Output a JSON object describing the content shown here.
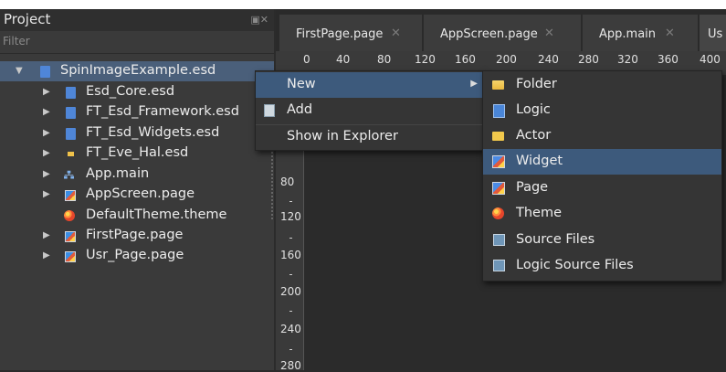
{
  "project": {
    "title": "Project",
    "filter_placeholder": "Filter",
    "tree": [
      {
        "label": "SpinImageExample.esd",
        "icon": "esd-file-icon",
        "expanded": true
      },
      {
        "label": "Esd_Core.esd",
        "icon": "esd-file-icon"
      },
      {
        "label": "FT_Esd_Framework.esd",
        "icon": "esd-file-icon"
      },
      {
        "label": "FT_Esd_Widgets.esd",
        "icon": "esd-file-icon"
      },
      {
        "label": "FT_Eve_Hal.esd",
        "icon": "esd-file-icon"
      },
      {
        "label": "App.main",
        "icon": "hierarchy-icon"
      },
      {
        "label": "AppScreen.page",
        "icon": "page-icon"
      },
      {
        "label": "DefaultTheme.theme",
        "icon": "theme-icon"
      },
      {
        "label": "FirstPage.page",
        "icon": "page-icon"
      },
      {
        "label": "Usr_Page.page",
        "icon": "page-icon"
      }
    ]
  },
  "tabs": [
    {
      "label": "FirstPage.page"
    },
    {
      "label": "AppScreen.page"
    },
    {
      "label": "App.main"
    },
    {
      "label": "Us"
    }
  ],
  "ruler": {
    "h_labels": [
      "0",
      "40",
      "80",
      "120",
      "160",
      "200",
      "240",
      "280",
      "320",
      "360",
      "400"
    ],
    "v_labels": [
      "80",
      "120",
      "160",
      "200",
      "240",
      "280"
    ]
  },
  "context_menu": {
    "items": [
      {
        "label": "New",
        "has_submenu": true,
        "active": true
      },
      {
        "label": "Add",
        "icon": "add-icon"
      },
      {
        "label": "Show in Explorer"
      }
    ]
  },
  "new_submenu": {
    "items": [
      {
        "label": "Folder",
        "icon": "folder-icon"
      },
      {
        "label": "Logic",
        "icon": "logic-icon"
      },
      {
        "label": "Actor",
        "icon": "actor-icon"
      },
      {
        "label": "Widget",
        "icon": "widget-icon",
        "highlighted": true
      },
      {
        "label": "Page",
        "icon": "page-icon"
      },
      {
        "label": "Theme",
        "icon": "theme-icon"
      },
      {
        "label": "Source Files",
        "icon": "source-files-icon"
      },
      {
        "label": "Logic Source Files",
        "icon": "logic-source-files-icon"
      }
    ]
  },
  "colors": {
    "selection": "#4a5f7a",
    "menu_highlight": "#3d5a7c"
  }
}
